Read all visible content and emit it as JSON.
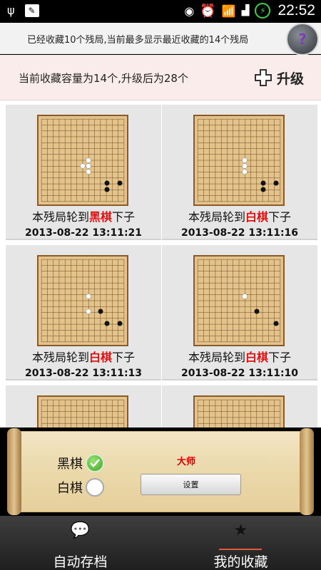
{
  "status_bar": {
    "time": "22:52"
  },
  "notice": {
    "text": "已经收藏10个残局,当前最多显示最近收藏的14个残局",
    "help_label": "?"
  },
  "capacity": {
    "text": "当前收藏容量为14个,升级后为28个",
    "upgrade_label": "升级"
  },
  "cards": [
    {
      "prefix": "本残局轮到",
      "color": "黑棋",
      "suffix": "下子",
      "time": "2013-08-22 13:11:21"
    },
    {
      "prefix": "本残局轮到",
      "color": "白棋",
      "suffix": "下子",
      "time": "2013-08-22 13:11:16"
    },
    {
      "prefix": "本残局轮到",
      "color": "白棋",
      "suffix": "下子",
      "time": "2013-08-22 13:11:13"
    },
    {
      "prefix": "本残局轮到",
      "color": "白棋",
      "suffix": "下子",
      "time": "2013-08-22 13:11:10"
    }
  ],
  "panel": {
    "black_label": "黑棋",
    "white_label": "白棋",
    "level": "大师",
    "settings_label": "设置"
  },
  "tabs": [
    {
      "label": "自动存档",
      "icon": "chat-icon"
    },
    {
      "label": "我的收藏",
      "icon": "star-icon"
    }
  ],
  "colors": {
    "highlight": "#e01010",
    "board": "#e4c38a",
    "accent": "#e25a3a"
  }
}
